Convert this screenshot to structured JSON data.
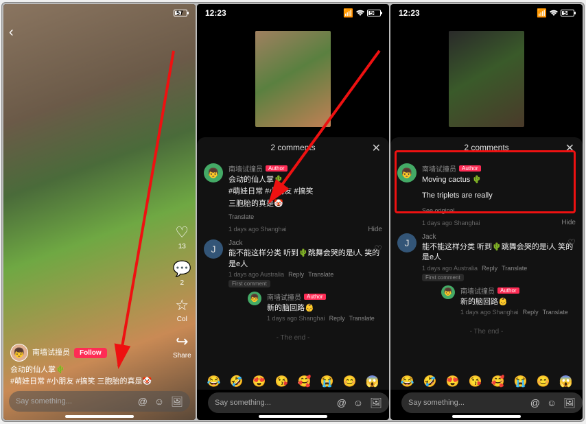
{
  "status": {
    "time": "12:23",
    "battery1": "57",
    "battery2": "56",
    "battery3": "56"
  },
  "screen1": {
    "author": "南墙试撞员",
    "follow": "Follow",
    "caption_line1": "会动的仙人掌🌵",
    "caption_line2": "#萌娃日常 #小朋友 #搞笑 三胞胎的真是🤡",
    "like_count": "13",
    "comment_count": "2",
    "star_label": "Col",
    "share_label": "Share",
    "say_placeholder": "Say something..."
  },
  "comments": {
    "header": "2 comments",
    "author_name": "南墙试撞员",
    "author_badge": "Author",
    "original_line1": "会动的仙人掌🌵",
    "original_line2": "#萌娃日常 #小朋友 #搞笑",
    "original_line3": "三胞胎的真是🤡",
    "translate": "Translate",
    "translated_line1": "Moving cactus 🌵",
    "translated_line2": "The triplets are really",
    "see_original": "See original",
    "timestamp": "1 days ago Shanghai",
    "hide": "Hide",
    "c2_name": "Jack",
    "c2_text": "能不能这样分类 听到🌵跳舞会哭的是i人 笑的是e人",
    "c2_meta_time": "1 days ago Australia",
    "reply": "Reply",
    "first_comment": "First comment",
    "reply_name": "南墙试撞员",
    "reply_text": "新的脑回路👶",
    "reply_meta": "1 days ago Shanghai",
    "the_end": "- The end -",
    "say_placeholder": "Say something..."
  },
  "emojis": [
    "😂",
    "🤣",
    "😍",
    "😘",
    "🥰",
    "😭",
    "😊",
    "😱"
  ]
}
